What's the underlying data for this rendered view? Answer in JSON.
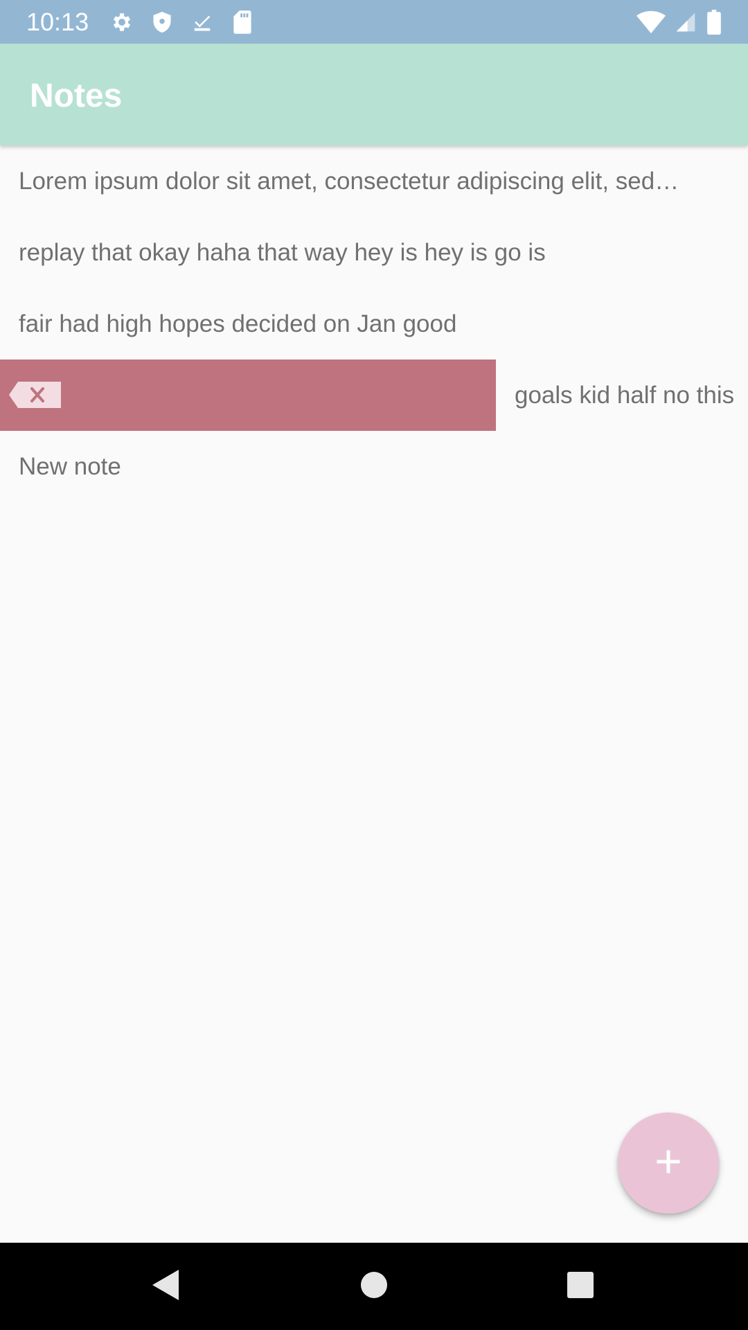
{
  "status_bar": {
    "time": "10:13",
    "left_icons": [
      "gear-icon",
      "shield-icon",
      "download-done-icon",
      "sd-card-icon"
    ],
    "right_icons": [
      "wifi-icon",
      "cell-signal-icon",
      "battery-icon"
    ]
  },
  "app_bar": {
    "title": "Notes",
    "color": "#b7e1d3"
  },
  "notes": [
    {
      "text": "Lorem ipsum dolor sit amet, consectetur adipiscing elit, sed…"
    },
    {
      "text": "replay that okay haha that way hey is hey is go is"
    },
    {
      "text": "fair had high hopes decided on Jan good"
    },
    {
      "text": "goals kid half no this",
      "swiped": true,
      "swipe_action_icon": "backspace-delete-icon",
      "swipe_color": "#be737e"
    },
    {
      "text": "New note"
    }
  ],
  "fab": {
    "icon": "plus-icon",
    "color": "#eac4d6"
  },
  "nav_bar": {
    "buttons": [
      "back-icon",
      "home-icon",
      "recents-icon"
    ]
  }
}
